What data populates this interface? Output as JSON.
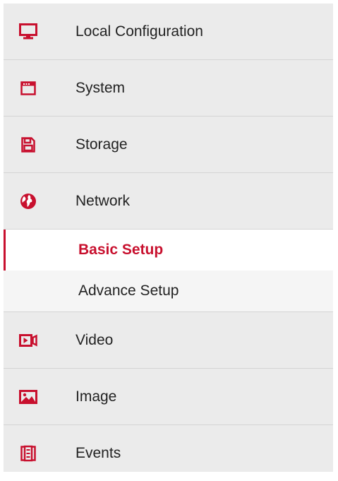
{
  "accent_color": "#c8102e",
  "menu": {
    "local_configuration": {
      "label": "Local Configuration",
      "icon": "monitor-icon"
    },
    "system": {
      "label": "System",
      "icon": "window-icon"
    },
    "storage": {
      "label": "Storage",
      "icon": "floppy-disk-icon"
    },
    "network": {
      "label": "Network",
      "icon": "globe-icon",
      "expanded": true,
      "submenu": [
        {
          "label": "Basic Setup",
          "active": true
        },
        {
          "label": "Advance Setup",
          "active": false
        }
      ]
    },
    "video": {
      "label": "Video",
      "icon": "video-camera-icon"
    },
    "image": {
      "label": "Image",
      "icon": "picture-icon"
    },
    "events": {
      "label": "Events",
      "icon": "events-list-icon"
    }
  }
}
